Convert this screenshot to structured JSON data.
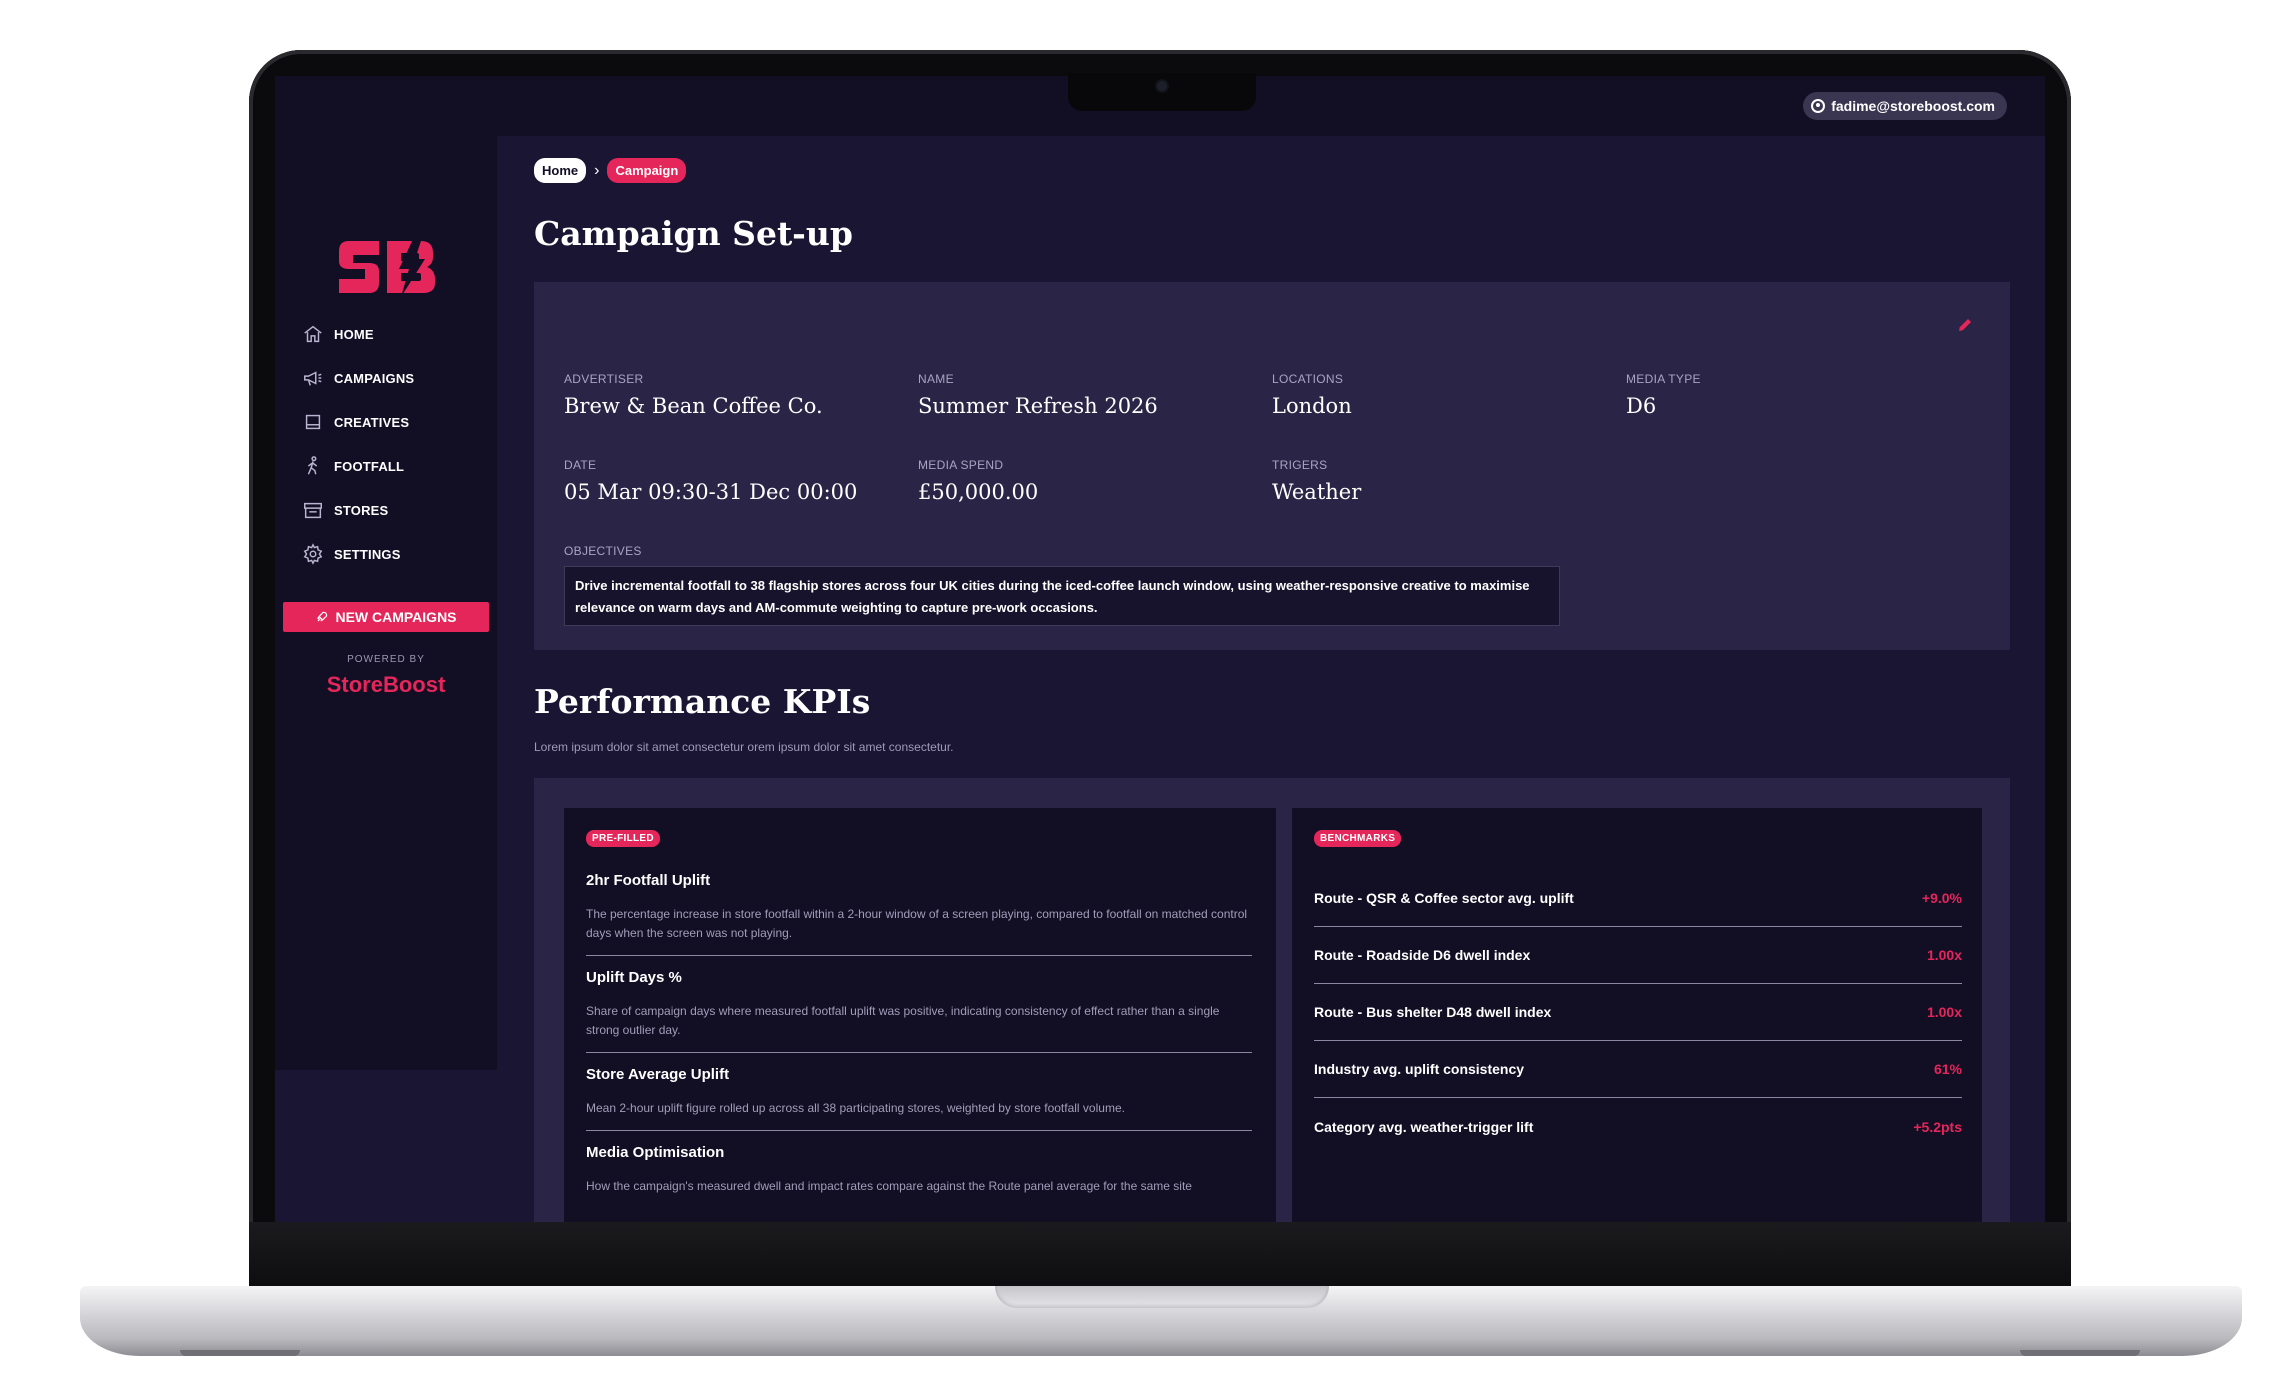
{
  "header": {
    "user_email": "fadime@storeboost.com"
  },
  "sidebar": {
    "items": [
      {
        "label": "HOME",
        "icon": "home-icon"
      },
      {
        "label": "CAMPAIGNS",
        "icon": "megaphone-icon"
      },
      {
        "label": "CREATIVES",
        "icon": "image-icon"
      },
      {
        "label": "FOOTFALL",
        "icon": "walking-person-icon"
      },
      {
        "label": "STORES",
        "icon": "store-icon"
      },
      {
        "label": "SETTINGS",
        "icon": "gear-icon"
      }
    ],
    "new_campaign_label": "NEW CAMPAIGNS",
    "powered_by": "POWERED BY",
    "brand_name": "StoreBoost"
  },
  "breadcrumb": {
    "home": "Home",
    "current": "Campaign"
  },
  "page_title": "Campaign Set-up",
  "campaign": {
    "advertiser_label": "ADVERTISER",
    "advertiser": "Brew & Bean Coffee Co.",
    "name_label": "NAME",
    "name": "Summer Refresh 2026",
    "locations_label": "LOCATIONS",
    "locations": "London",
    "media_type_label": "MEDIA TYPE",
    "media_type": "D6",
    "date_label": "DATE",
    "date": "05 Mar 09:30-31 Dec 00:00",
    "media_spend_label": "MEDIA SPEND",
    "media_spend": "£50,000.00",
    "triggers_label": "TRIGERS",
    "triggers": "Weather",
    "objectives_label": "OBJECTIVES",
    "objectives": "Drive incremental footfall to 38 flagship stores across four UK cities during the iced-coffee launch window, using weather-responsive creative to maximise relevance on warm days and AM-commute weighting to capture pre-work occasions."
  },
  "kpis": {
    "title": "Performance KPIs",
    "subtitle": "Lorem ipsum dolor sit amet consectetur orem ipsum dolor sit amet consectetur.",
    "prefilled_tag": "PRE-FILLED",
    "items": [
      {
        "name": "2hr Footfall Uplift",
        "desc": "The percentage increase in store footfall within a 2-hour window of a screen playing, compared to footfall on matched control days when the screen was not playing."
      },
      {
        "name": "Uplift Days %",
        "desc": "Share of campaign days where measured footfall uplift was positive, indicating consistency of effect rather than a single strong outlier day."
      },
      {
        "name": "Store Average Uplift",
        "desc": "Mean 2-hour uplift figure rolled up across all 38 participating stores, weighted by store footfall volume."
      },
      {
        "name": "Media Optimisation",
        "desc": "How the campaign's measured dwell and impact rates compare against the Route panel average for the same site"
      }
    ],
    "benchmarks_tag": "BENCHMARKS",
    "benchmarks": [
      {
        "label": "Route - QSR & Coffee sector avg. uplift",
        "value": "+9.0%"
      },
      {
        "label": "Route - Roadside D6 dwell index",
        "value": "1.00x"
      },
      {
        "label": "Route - Bus shelter D48 dwell index",
        "value": "1.00x"
      },
      {
        "label": "Industry avg. uplift consistency",
        "value": "61%"
      },
      {
        "label": "Category avg. weather-trigger lift",
        "value": "+5.2pts"
      }
    ]
  },
  "colors": {
    "accent": "#e5265a",
    "background": "#1a1532",
    "sidebar": "#120e24",
    "card": "#2a2546"
  }
}
